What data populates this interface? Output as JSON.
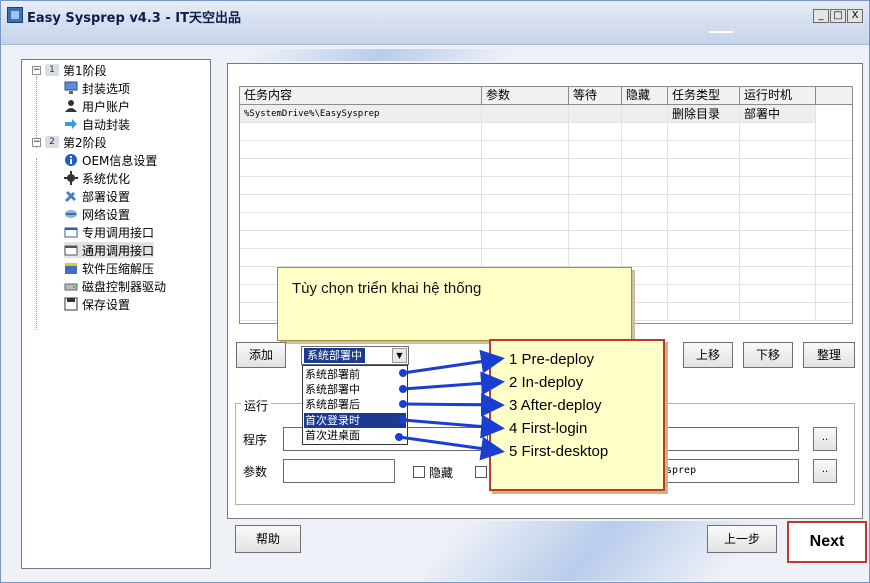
{
  "window": {
    "title": "Easy Sysprep v4.3 - IT天空出品",
    "controls": {
      "minimize": "_",
      "maximize": "□",
      "close": "X"
    }
  },
  "tree": {
    "stages": [
      {
        "number": "1",
        "label": "第1阶段",
        "expander": "−",
        "items": [
          {
            "label": "封装选项",
            "icon": "monitor-icon"
          },
          {
            "label": "用户账户",
            "icon": "user-icon"
          },
          {
            "label": "自动封装",
            "icon": "arrow-icon"
          }
        ]
      },
      {
        "number": "2",
        "label": "第2阶段",
        "expander": "−",
        "items": [
          {
            "label": "OEM信息设置",
            "icon": "info-icon"
          },
          {
            "label": "系统优化",
            "icon": "gear-icon"
          },
          {
            "label": "部署设置",
            "icon": "tools-icon"
          },
          {
            "label": "网络设置",
            "icon": "network-icon"
          },
          {
            "label": "专用调用接口",
            "icon": "window-icon"
          },
          {
            "label": "通用调用接口",
            "icon": "window-icon",
            "selected": true
          },
          {
            "label": "软件压缩解压",
            "icon": "package-icon"
          },
          {
            "label": "磁盘控制器驱动",
            "icon": "disk-icon"
          },
          {
            "label": "保存设置",
            "icon": "save-icon"
          }
        ]
      }
    ]
  },
  "table": {
    "headers": [
      "任务内容",
      "参数",
      "等待",
      "隐藏",
      "任务类型",
      "运行时机"
    ],
    "rows": [
      [
        "%SystemDrive%\\EasySysprep",
        "",
        "",
        "",
        "删除目录",
        "部署中"
      ]
    ]
  },
  "callout": {
    "text": "Tùy chọn triển khai hệ thống"
  },
  "toolbar": {
    "add_label": "添加",
    "up_label": "上移",
    "down_label": "下移",
    "organize_label": "整理"
  },
  "combo": {
    "selected": "系统部署中",
    "options": [
      "系统部署前",
      "系统部署中",
      "系统部署后",
      "首次登录时",
      "首次进桌面"
    ],
    "highlighted_index": 3
  },
  "run_group": {
    "title": "运行",
    "program_label": "程序",
    "program_value": "",
    "params_label": "参数",
    "params_value": "",
    "hide_label": "隐藏",
    "path_value": "sprep",
    "browse_label": ".."
  },
  "annotation": {
    "lines": [
      "1 Pre-deploy",
      "2 In-deploy",
      "3 After-deploy",
      "4 First-login",
      "5 First-desktop"
    ]
  },
  "footer": {
    "help_label": "帮助",
    "prev_label": "上一步",
    "next_label": "Next"
  },
  "colors": {
    "accent": "#1c3a8f",
    "highlight_border": "#c0392b",
    "callout_bg": "#ffffc8",
    "arrow": "#1a3fd0"
  }
}
